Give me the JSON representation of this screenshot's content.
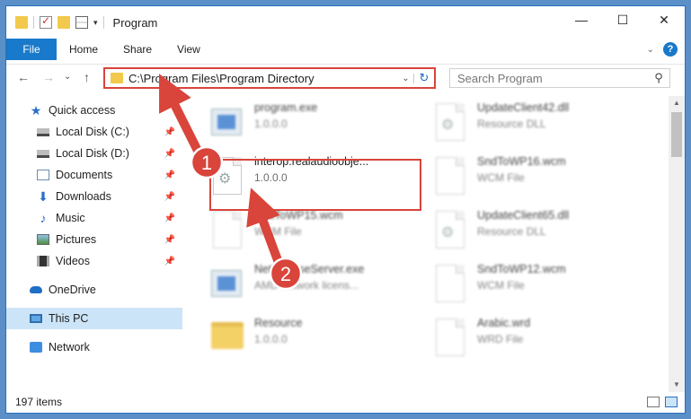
{
  "window": {
    "title": "Program"
  },
  "controls": {
    "minimize": "—",
    "maximize": "☐",
    "close": "✕"
  },
  "ribbon": {
    "tabs": [
      "File",
      "Home",
      "Share",
      "View"
    ],
    "help": "?"
  },
  "nav": {
    "back": "←",
    "forward": "→",
    "recent": "⌄",
    "up": "↑"
  },
  "address": {
    "path": "C:\\Program Files\\Program Directory",
    "dropdown": "⌄",
    "refresh": "↻"
  },
  "search": {
    "placeholder": "Search Program",
    "icon": "⚲"
  },
  "sidebar": {
    "items": [
      {
        "label": "Quick access",
        "icon": "star-icon"
      },
      {
        "label": "Local Disk (C:)",
        "icon": "disk-icon"
      },
      {
        "label": "Local Disk (D:)",
        "icon": "disk-icon"
      },
      {
        "label": "Documents",
        "icon": "documents-icon"
      },
      {
        "label": "Downloads",
        "icon": "download-icon"
      },
      {
        "label": "Music",
        "icon": "music-icon"
      },
      {
        "label": "Pictures",
        "icon": "pictures-icon"
      },
      {
        "label": "Videos",
        "icon": "videos-icon"
      },
      {
        "label": "OneDrive",
        "icon": "cloud-icon"
      },
      {
        "label": "This PC",
        "icon": "computer-icon"
      },
      {
        "label": "Network",
        "icon": "network-icon"
      }
    ]
  },
  "files": {
    "left": [
      {
        "name": "program.exe",
        "sub": "1.0.0.0",
        "icon": "exe-icon"
      },
      {
        "name": "interop.realaudioobje...",
        "sub": "1.0.0.0",
        "icon": "dll-icon"
      },
      {
        "name": "SndToWP15.wcm",
        "sub": "WCM File",
        "icon": "file-icon"
      },
      {
        "name": "NetLicenseServer.exe",
        "sub": "AMD network licens...",
        "icon": "exe-icon"
      },
      {
        "name": "Resource",
        "sub": "1.0.0.0",
        "icon": "folder-icon"
      }
    ],
    "right": [
      {
        "name": "UpdateClient42.dll",
        "sub": "Resource DLL",
        "icon": "dll-icon"
      },
      {
        "name": "SndToWP16.wcm",
        "sub": "WCM File",
        "icon": "file-icon"
      },
      {
        "name": "UpdateClient65.dll",
        "sub": "Resource DLL",
        "icon": "dll-icon"
      },
      {
        "name": "SndToWP12.wcm",
        "sub": "WCM File",
        "icon": "file-icon"
      },
      {
        "name": "Arabic.wrd",
        "sub": "WRD File",
        "icon": "file-icon"
      }
    ]
  },
  "status": {
    "count": "197 items"
  },
  "annotations": {
    "step1": "1",
    "step2": "2",
    "color": "#d9443b"
  }
}
